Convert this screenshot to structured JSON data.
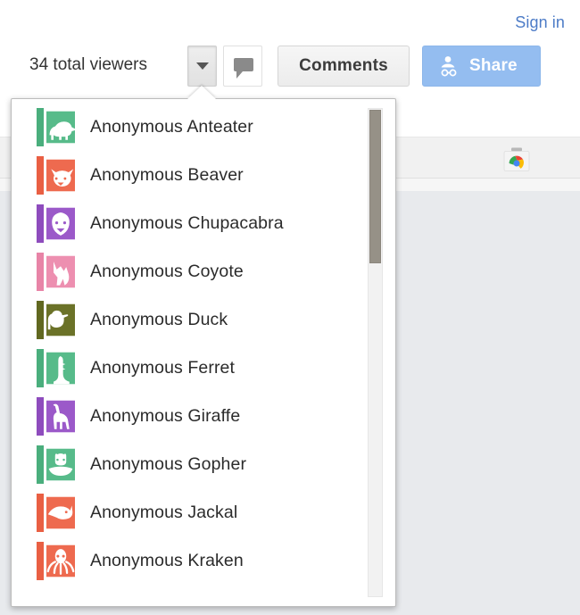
{
  "topbar": {
    "signin_label": "Sign in",
    "viewers_label": "34 total viewers",
    "viewer_count": 34,
    "caret_icon": "chevron-down-icon",
    "comment_bubble_icon": "comment-bubble-icon",
    "comments_label": "Comments",
    "share_label": "Share",
    "share_icon": "person-add-icon",
    "share_button_color": "#94bdf0",
    "signin_link_color": "#4d7cc7"
  },
  "background": {
    "webstore_icon": "chrome-webstore-briefcase-icon",
    "toolbar_strip_color": "#f1f1f1",
    "canvas_color": "#e8eaed"
  },
  "viewers_popup": {
    "scrollbar": {
      "thumb_color": "#969187",
      "track_color": "#f2f2f2"
    },
    "items": [
      {
        "name": "Anonymous Anteater",
        "animal": "anteater",
        "color": "#57bb8a",
        "stripe": "#4aae7d"
      },
      {
        "name": "Anonymous Beaver",
        "animal": "beaver",
        "color": "#ee6a4f",
        "stripe": "#e95f43"
      },
      {
        "name": "Anonymous Chupacabra",
        "animal": "chupacabra",
        "color": "#9b59c9",
        "stripe": "#8e4cbd"
      },
      {
        "name": "Anonymous Coyote",
        "animal": "coyote",
        "color": "#ed8fb0",
        "stripe": "#e884a7"
      },
      {
        "name": "Anonymous Duck",
        "animal": "duck",
        "color": "#6b7228",
        "stripe": "#616820"
      },
      {
        "name": "Anonymous Ferret",
        "animal": "ferret",
        "color": "#57bb8a",
        "stripe": "#4aae7d"
      },
      {
        "name": "Anonymous Giraffe",
        "animal": "giraffe",
        "color": "#9b59c9",
        "stripe": "#8e4cbd"
      },
      {
        "name": "Anonymous Gopher",
        "animal": "gopher",
        "color": "#57bb8a",
        "stripe": "#4aae7d"
      },
      {
        "name": "Anonymous Jackal",
        "animal": "jackal",
        "color": "#ee6a4f",
        "stripe": "#e95f43"
      },
      {
        "name": "Anonymous Kraken",
        "animal": "kraken",
        "color": "#ee6a4f",
        "stripe": "#e95f43"
      }
    ]
  }
}
